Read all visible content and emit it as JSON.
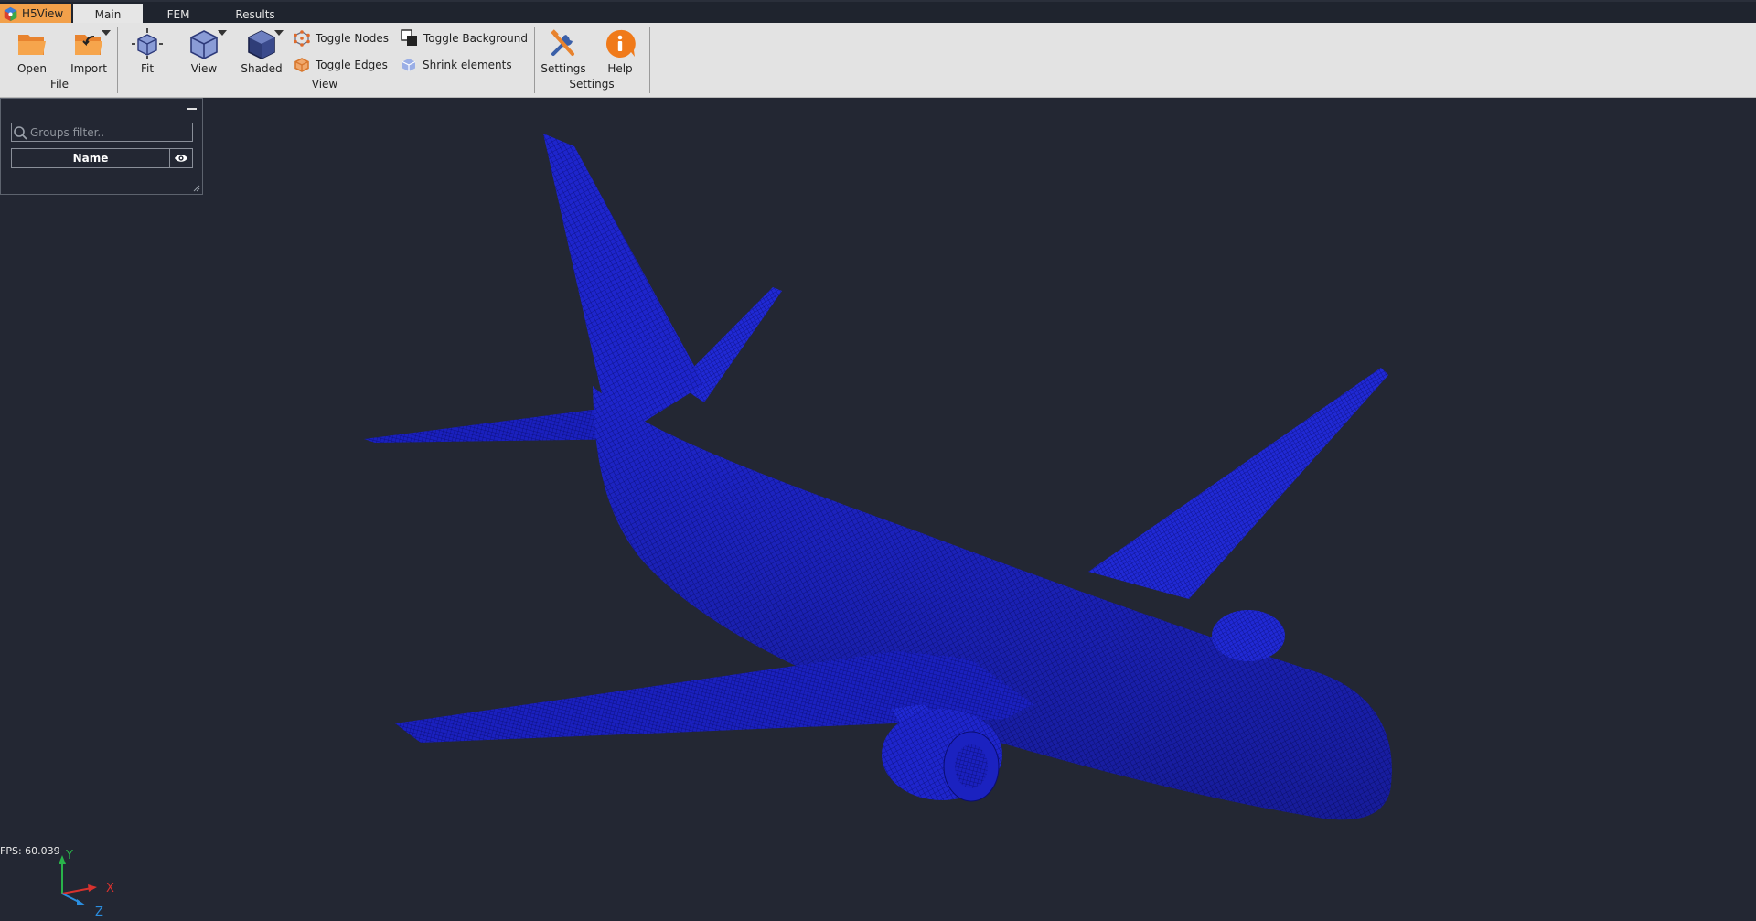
{
  "app": {
    "name": "H5View"
  },
  "tabs": [
    {
      "label": "Main",
      "active": true
    },
    {
      "label": "FEM",
      "active": false
    },
    {
      "label": "Results",
      "active": false
    }
  ],
  "ribbon": {
    "file": {
      "group_label": "File",
      "open": "Open",
      "import": "Import"
    },
    "view": {
      "group_label": "View",
      "fit": "Fit",
      "view": "View",
      "shaded": "Shaded",
      "toggle_nodes": "Toggle Nodes",
      "toggle_edges": "Toggle Edges",
      "toggle_background": "Toggle Background",
      "shrink_elements": "Shrink elements"
    },
    "settings": {
      "group_label": "Settings",
      "settings": "Settings",
      "help": "Help"
    }
  },
  "groups_panel": {
    "search_placeholder": "Groups filter..",
    "column_name": "Name"
  },
  "axes": {
    "x": "X",
    "y": "Y",
    "z": "Z"
  },
  "status": {
    "fps": "FPS: 60.039"
  },
  "colors": {
    "accent": "#f2a04a",
    "viewport_bg": "#232733",
    "mesh": "#1c22c8",
    "mesh_line": "#0a0e7a"
  }
}
